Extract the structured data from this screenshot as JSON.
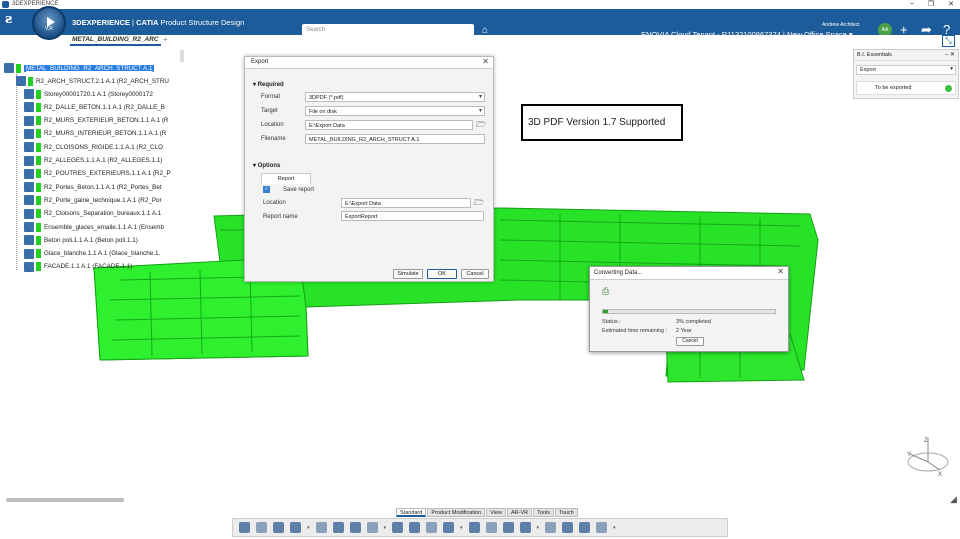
{
  "window": {
    "title": "3DEXPERIENCE"
  },
  "header": {
    "brand_bold": "3DEXPERIENCE",
    "brand_sep": " | ",
    "brand_catia": "CATIA",
    "brand_app": " Product Structure Design",
    "search_placeholder": "Search",
    "user_name": "Andrew Architect",
    "tenant": "ENOVIA Cloud Tenant - R1132100867374 | New Office Space ▾",
    "avatar_initials": "AA",
    "compass_label": "V,R"
  },
  "tabs": {
    "active": "METAL_BUILDING_R2_ARC",
    "add": "+"
  },
  "tree": {
    "root": "METAL_BUILDING_R2_ARCH_STRUCT A.1",
    "child": "R2_ARCH_STRUCT.2.1 A.1 (R2_ARCH_STRU",
    "items": [
      "Storey00001720.1 A.1 (Storey0000172",
      "R2_DALLE_BETON.1.1 A.1 (R2_DALLE_B",
      "R2_MURS_EXTERIEUR_BETON.1.1 A.1 (R",
      "R2_MURS_INTERIEUR_BETON.1.1 A.1 (R",
      "R2_CLOISONS_RIGIDE.1.1 A.1 (R2_CLO",
      "R2_ALLEGES.1.1 A.1 (R2_ALLEGES.1.1)",
      "R2_POUTRES_EXTERIEURS.1.1 A.1 (R2_P",
      "R2_Portes_Beton.1.1 A.1 (R2_Portes_Bet",
      "R2_Porte_gaine_technique.1 A.1 (R2_Por",
      "R2_Cloisons_Separation_bureaux.1.1 A.1",
      "Ensemble_glaces_emaile.1.1 A.1 (Ensemb",
      "Beton poli.1.1 A.1 (Beton poli.1.1)",
      "Glace_blanche.1.1 A.1 (Glace_blanche.1.",
      "FACADE.1.1 A.1 (FACADE.1.1)"
    ]
  },
  "export_dialog": {
    "title": "Export",
    "required": "Required",
    "format_label": "Format",
    "format_value": "3DPDF (*.pdf)",
    "target_label": "Target",
    "target_value": "File on disk",
    "location_label": "Location",
    "location_value": "E:\\Export Data",
    "filename_label": "Filename",
    "filename_value": "METAL_BUILDING_R2_ARCH_STRUCT A.1",
    "options": "Options",
    "report_tab": "Report",
    "save_report": "Save report",
    "report_location_label": "Location",
    "report_location_value": "E:\\Export Data",
    "report_name_label": "Report name",
    "report_name_value": "ExportReport",
    "simulate": "Simulate",
    "ok": "OK",
    "cancel": "Cancel"
  },
  "annotation": "3D  PDF Version 1.7 Supported",
  "bi_panel": {
    "title": "B.I. Essentials",
    "select": "Export",
    "row": "To be exported",
    "dot_color": "#3bc13b"
  },
  "convert_dialog": {
    "title": "Converting Data...",
    "status_label": "Status :",
    "status_value": "3% completed",
    "time_label": "Estimated time remaining :",
    "time_value": "2 Year",
    "cancel": "Cancel",
    "progress": 0.03
  },
  "bottom_tabs": [
    "Standard",
    "Product Modification",
    "View",
    "AR-VR",
    "Tools",
    "Touch"
  ],
  "colors": {
    "accent": "#1d5c9a",
    "model": "#2ee62e"
  }
}
